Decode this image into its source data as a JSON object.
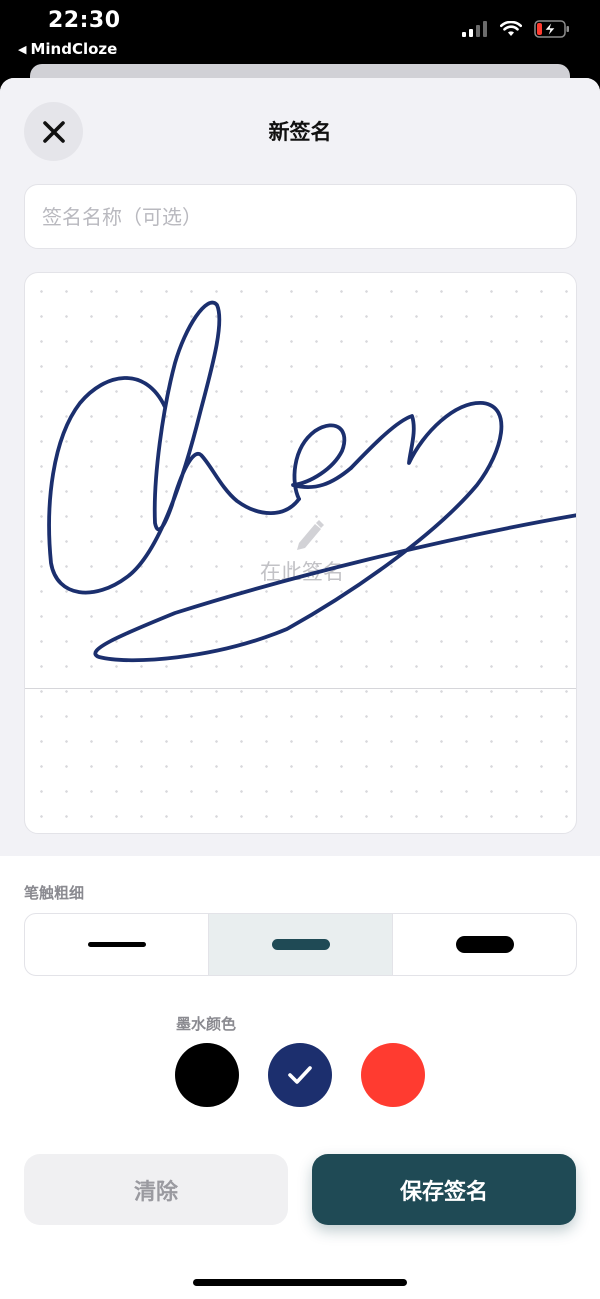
{
  "status_bar": {
    "time": "22:30",
    "back_app": "MindCloze",
    "icons": [
      "cellular-signal-icon",
      "wifi-icon",
      "battery-charging-icon"
    ],
    "battery_color": "#ff3b30"
  },
  "header": {
    "title": "新签名",
    "close_icon": "close-icon"
  },
  "name_input": {
    "value": "",
    "placeholder": "签名名称（可选）"
  },
  "canvas": {
    "hint": "在此签名",
    "hint_icon": "pencil-icon",
    "ink_color": "#1b2f6e"
  },
  "stroke_width": {
    "label": "笔触粗细",
    "options": [
      "thin",
      "medium",
      "thick"
    ],
    "selected": "medium"
  },
  "ink_color": {
    "label": "墨水颜色",
    "options": [
      {
        "name": "black",
        "color": "#000000"
      },
      {
        "name": "navy",
        "color": "#1c2f6e"
      },
      {
        "name": "red",
        "color": "#ff3b30"
      }
    ],
    "selected": "navy"
  },
  "actions": {
    "clear": "清除",
    "save": "保存签名"
  },
  "accent_color": "#1f4a55"
}
